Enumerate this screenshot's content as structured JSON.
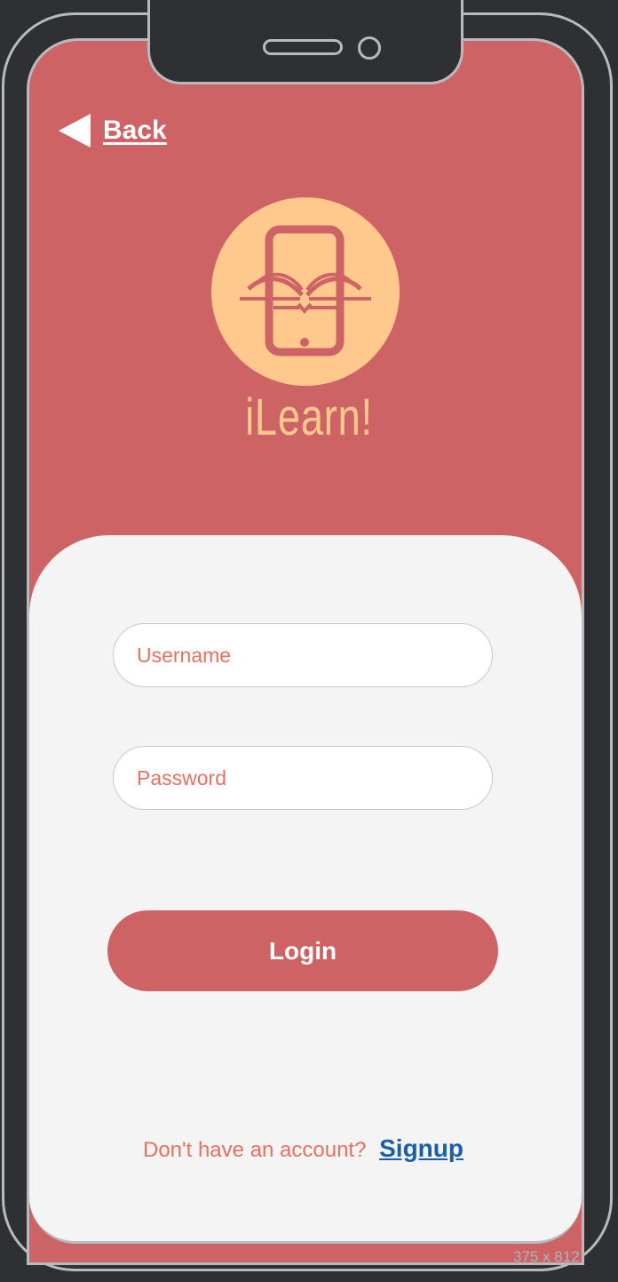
{
  "nav": {
    "back_label": "Back"
  },
  "brand": {
    "name": "iLearn!",
    "logo_icon": "phone-with-open-book-icon",
    "logo_color": "#ffc98d"
  },
  "form": {
    "username_placeholder": "Username",
    "password_placeholder": "Password",
    "login_label": "Login"
  },
  "footer": {
    "prompt": "Don't have an account?",
    "signup_label": "Signup"
  },
  "device": {
    "size_label": "375 x 812"
  },
  "colors": {
    "primary": "#cd6364",
    "accent_text": "#e8705f",
    "link": "#1c5fa8",
    "card": "#f4f4f4"
  }
}
